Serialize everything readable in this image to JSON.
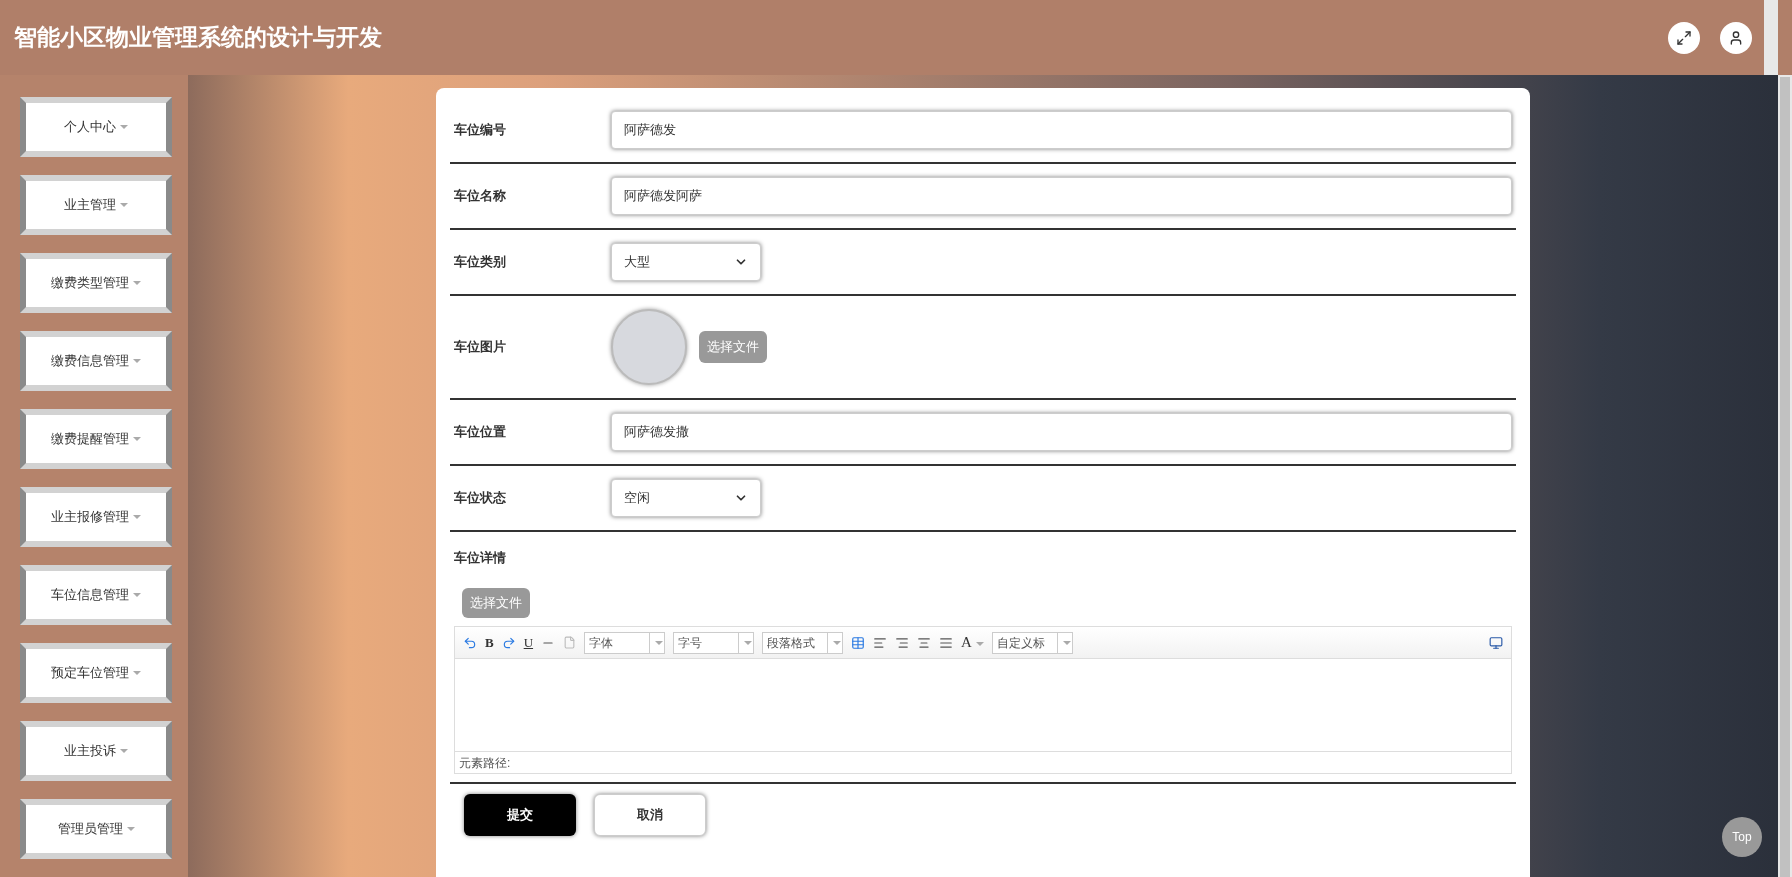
{
  "header": {
    "title": "智能小区物业管理系统的设计与开发"
  },
  "sidebar": {
    "items": [
      {
        "label": "个人中心"
      },
      {
        "label": "业主管理"
      },
      {
        "label": "缴费类型管理"
      },
      {
        "label": "缴费信息管理"
      },
      {
        "label": "缴费提醒管理"
      },
      {
        "label": "业主报修管理"
      },
      {
        "label": "车位信息管理"
      },
      {
        "label": "预定车位管理"
      },
      {
        "label": "业主投诉"
      },
      {
        "label": "管理员管理"
      }
    ]
  },
  "form": {
    "fields": [
      {
        "kind": "text",
        "label": "车位编号",
        "value": "阿萨德发"
      },
      {
        "kind": "text",
        "label": "车位名称",
        "value": "阿萨德发阿萨"
      },
      {
        "kind": "select",
        "label": "车位类别",
        "value": "大型"
      },
      {
        "kind": "image",
        "label": "车位图片",
        "button": "选择文件"
      },
      {
        "kind": "text",
        "label": "车位位置",
        "value": "阿萨德发撒"
      },
      {
        "kind": "select",
        "label": "车位状态",
        "value": "空闲"
      },
      {
        "kind": "editor",
        "label": "车位详情",
        "button": "选择文件",
        "bold": "B",
        "underline": "U",
        "font": "字体",
        "size": "字号",
        "paragraph": "段落格式",
        "font_color_label": "A",
        "custom_title": "自定义标",
        "path_label": "元素路径:"
      }
    ],
    "buttons": [
      {
        "kind": "primary",
        "label": "提交"
      },
      {
        "kind": "secondary",
        "label": "取消"
      }
    ]
  },
  "back_to_top": "Top"
}
